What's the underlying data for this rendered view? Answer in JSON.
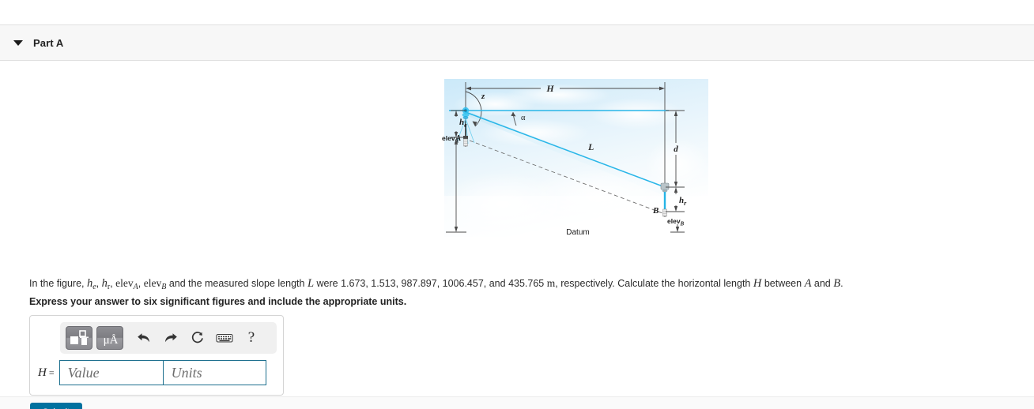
{
  "part": {
    "title": "Part A",
    "caret_icon": "caret-down-icon"
  },
  "figure": {
    "alt": "Surveying diagram: EDM slope measurement between stations A and B over a datum",
    "labels": {
      "H": "H",
      "z": "z",
      "alpha": "α",
      "L": "L",
      "d": "d",
      "A": "A",
      "B": "B",
      "he": "h",
      "he_sub": "e",
      "hr": "h",
      "hr_sub": "r",
      "elevA": "elev",
      "elevA_sub": "A",
      "elevB": "elev",
      "elevB_sub": "B",
      "datum": "Datum"
    },
    "colors": {
      "sky_top": "#d9eefb",
      "sky_bottom": "#ffffff",
      "beam": "#29b6e8",
      "dimension_line": "#4a4a4a",
      "dashed_line": "#6b6b6b"
    }
  },
  "question": {
    "prefix": "In the figure, ",
    "he": "h",
    "he_sub": "e",
    "sep1": ", ",
    "hr": "h",
    "hr_sub": "r",
    "sep2": ", ",
    "elev": "elev",
    "elevA_sub": "A",
    "sep3": ", ",
    "elev2": "elev",
    "elevB_sub": "B",
    "mid": " and the measured slope length ",
    "L": "L",
    "values_text": " were 1.673, 1.513, 987.897, 1006.457, and 435.765 ",
    "unit": "m",
    "tail": ", respectively. Calculate the horizontal length ",
    "H": "H",
    "between": " between ",
    "A": "A",
    "and": " and ",
    "B": "B",
    "period": ".",
    "instruction": "Express your answer to six significant figures and include the appropriate units."
  },
  "answer": {
    "label": "H",
    "equals": " =",
    "value_placeholder": "Value",
    "units_placeholder": "Units",
    "toolbar": {
      "template_icon": "math-template-icon",
      "units_icon": "micro-angstrom-units-icon",
      "units_label": "μÅ",
      "undo_icon": "undo-arrow-icon",
      "redo_icon": "redo-arrow-icon",
      "reset_icon": "reset-circular-arrow-icon",
      "keyboard_icon": "keyboard-icon",
      "help_icon": "help-question-icon",
      "help_label": "?"
    }
  },
  "submit": {
    "label": "Submit",
    "color": "#00719f"
  }
}
